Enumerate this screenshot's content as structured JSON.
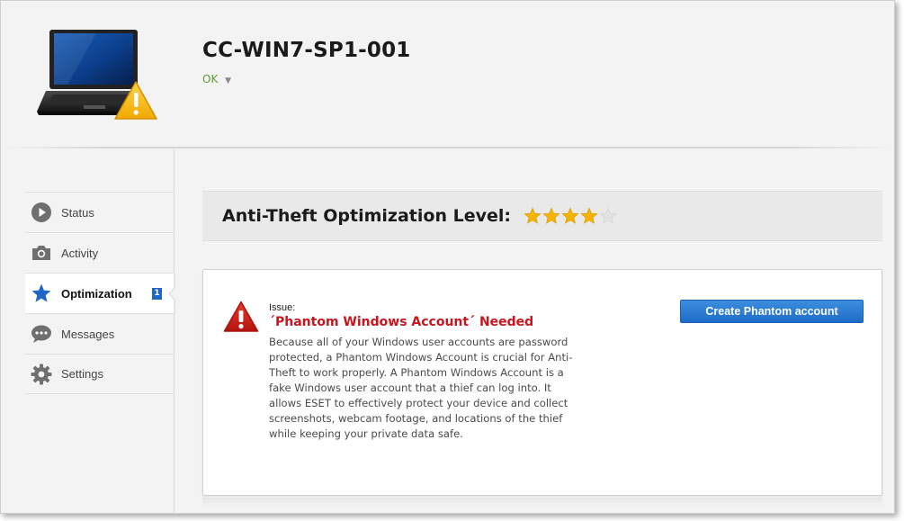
{
  "device": {
    "name": "CC-WIN7-SP1-001",
    "status": "OK",
    "status_caret": "▼",
    "icon": "laptop-warning-icon"
  },
  "sidebar": {
    "items": [
      {
        "label": "Status",
        "icon": "play-circle-icon",
        "active": false
      },
      {
        "label": "Activity",
        "icon": "camera-icon",
        "active": false
      },
      {
        "label": "Optimization",
        "icon": "star-icon",
        "active": true,
        "badge": "1"
      },
      {
        "label": "Messages",
        "icon": "chat-bubble-icon",
        "active": false
      },
      {
        "label": "Settings",
        "icon": "gear-icon",
        "active": false
      }
    ]
  },
  "main": {
    "level_title": "Anti-Theft Optimization Level:",
    "rating": {
      "value": 4,
      "max": 5
    },
    "issue": {
      "label": "Issue:",
      "title": "´Phantom Windows Account´ Needed",
      "description": "Because all of your Windows user accounts are password protected, a Phantom Windows Account is crucial for Anti-Theft to work properly. A Phantom Windows Account is a fake Windows user account that a thief can log into. It allows ESET to effectively protect your device and collect screenshots, webcam footage, and locations of the thief while keeping your private data safe.",
      "icon": "warning-triangle-icon"
    },
    "cta_label": "Create Phantom account"
  },
  "colors": {
    "accent_blue": "#1e6cc8",
    "issue_red": "#c8141e",
    "status_green": "#5aa02c",
    "star_gold": "#f5b400"
  }
}
